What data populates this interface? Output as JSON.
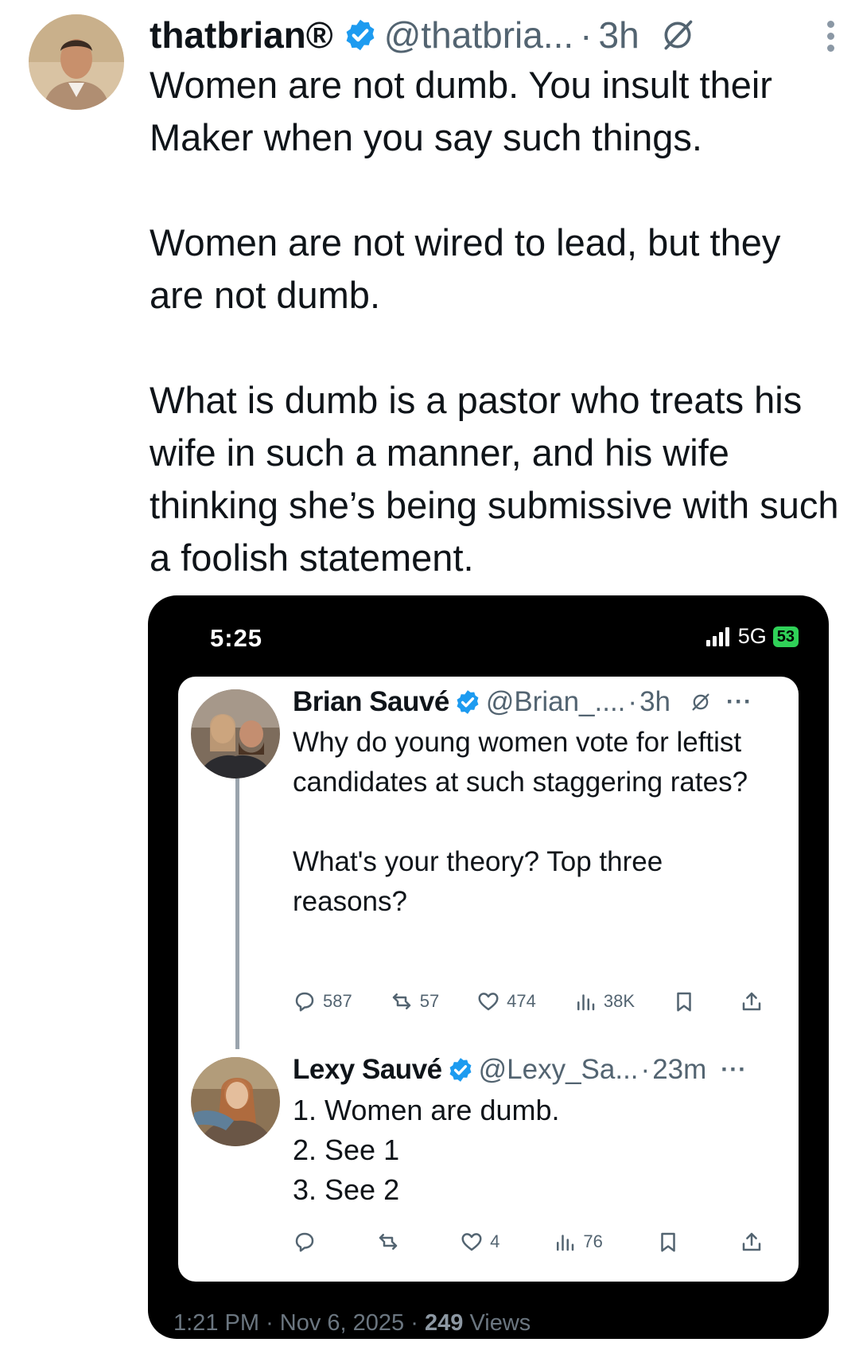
{
  "outer_tweet": {
    "display_name": "thatbrian®",
    "handle": "@thatbria...",
    "separator": "·",
    "time": "3h",
    "paragraphs": [
      "Women are not dumb. You insult their Maker when you say such things.",
      "Women are not wired to lead, but they are not dumb.",
      "What is dumb is a pastor who treats his wife in such a manner, and his wife thinking she’s being submissive with such a foolish statement."
    ],
    "icons": {
      "verified": "verified-badge-icon",
      "grok": "grok-icon",
      "more": "more-vertical-icon"
    },
    "colors": {
      "verified": "#1d9bf0",
      "text": "#0f1419",
      "secondary": "#536471"
    }
  },
  "screenshot": {
    "status_bar": {
      "time": "5:25",
      "network": "5G",
      "battery": "53"
    },
    "tweet1": {
      "name": "Brian Sauvé",
      "handle": "@Brian_....",
      "separator": "·",
      "time": "3h",
      "more": "···",
      "paragraphs": [
        "Why do young women vote for leftist candidates at such staggering rates?",
        "What's your theory? Top three reasons?"
      ],
      "replies": "587",
      "reposts": "57",
      "likes": "474",
      "views": "38K"
    },
    "tweet2": {
      "name": "Lexy Sauvé",
      "handle": "@Lexy_Sa...",
      "separator": "·",
      "time": "23m",
      "more": "···",
      "lines": [
        "1. Women are dumb.",
        "2. See 1",
        "3. See 2"
      ],
      "likes": "4",
      "views": "76"
    },
    "footer": {
      "time": "1:21 PM",
      "date": "Nov 6, 2025",
      "views_count": "249",
      "views_label": "Views",
      "sep": "·"
    }
  }
}
